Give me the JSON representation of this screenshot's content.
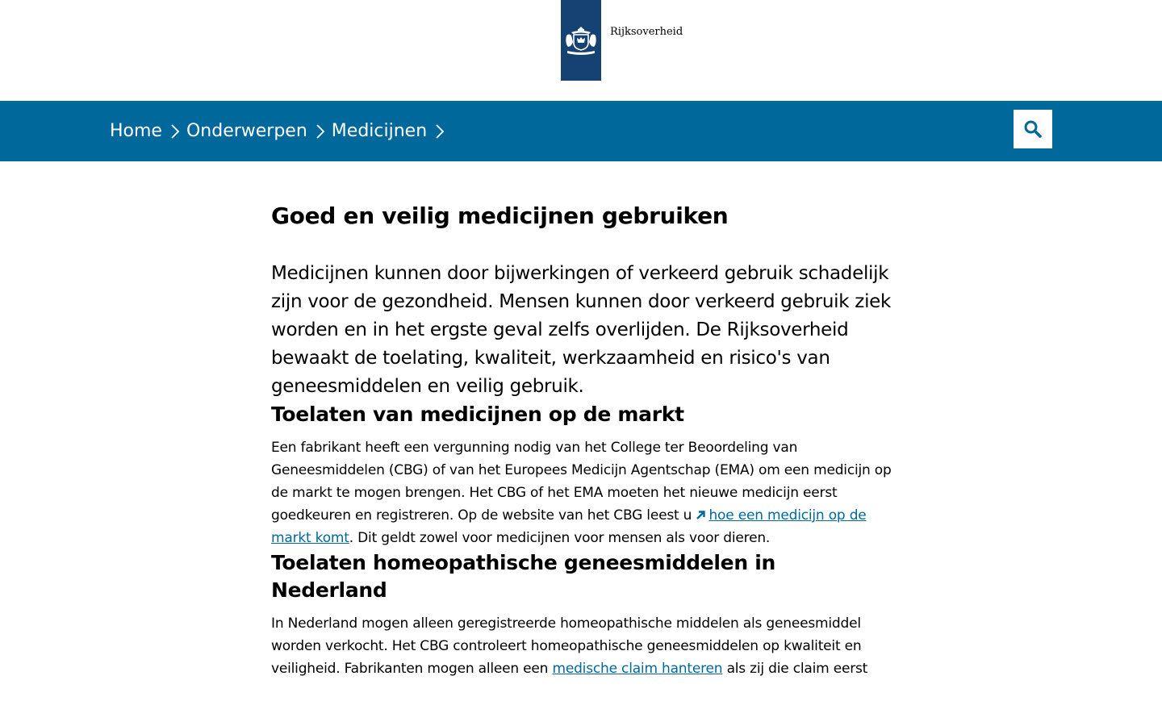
{
  "header": {
    "logo_text": "Rijksoverheid"
  },
  "breadcrumb": [
    {
      "label": "Home"
    },
    {
      "label": "Onderwerpen"
    },
    {
      "label": "Medicijnen"
    }
  ],
  "search": {
    "icon": "search-icon"
  },
  "main": {
    "title": "Goed en veilig medicijnen gebruiken",
    "intro": "Medicijnen kunnen door bijwerkingen of verkeerd gebruik schadelijk zijn voor de gezondheid. Mensen kunnen door verkeerd gebruik ziek worden en in het ergste geval zelfs overlijden. De Rijksoverheid bewaakt de toelating, kwaliteit, werkzaamheid en risico's van geneesmiddelen en veilig gebruik.",
    "section1": {
      "title": "Toelaten van medicijnen op de markt",
      "text_before": "Een fabrikant heeft een vergunning nodig van het College ter Beoordeling van Geneesmiddelen (CBG) of van het Europees Medicijn Agentschap (EMA) om een medicijn op de markt te mogen brengen. Het CBG of het EMA moeten het nieuwe medicijn eerst goedkeuren en registreren. Op de website van het CBG leest u ",
      "link": "hoe een medicijn op de markt komt",
      "text_after": ". Dit geldt zowel voor medicijnen voor mensen als voor dieren."
    },
    "section2": {
      "title": "Toelaten homeopathische geneesmiddelen in Nederland",
      "text_before": "In Nederland mogen alleen geregistreerde homeopathische middelen als geneesmiddel worden verkocht. Het CBG controleert homeopathische geneesmiddelen op kwaliteit en veiligheid. Fabrikanten mogen alleen een ",
      "link": "medische claim hanteren",
      "text_after": " als zij die claim eerst"
    }
  },
  "colors": {
    "brand": "#154273",
    "nav": "#01689b",
    "link": "#01689b"
  }
}
